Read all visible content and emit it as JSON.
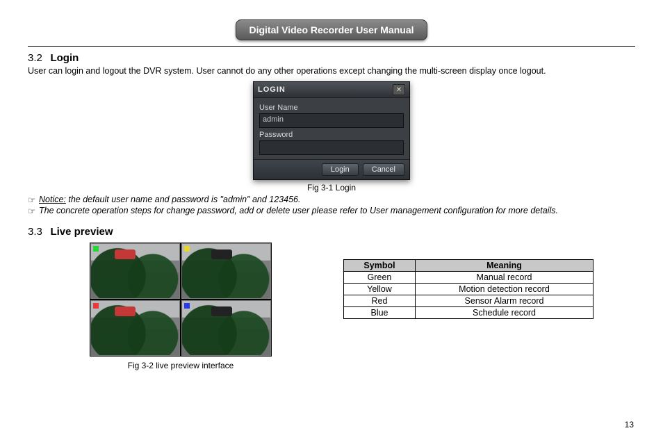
{
  "doc_title": "Digital Video Recorder User Manual",
  "page_number": "13",
  "section32": {
    "num": "3.2",
    "title": "Login",
    "para": "User can login and logout the DVR system. User cannot do any other operations except changing the multi-screen display once logout."
  },
  "login_dialog": {
    "title": "LOGIN",
    "user_label": "User  Name",
    "user_value": "admin",
    "password_label": "Password",
    "password_value": "",
    "login_btn": "Login",
    "cancel_btn": "Cancel",
    "close_glyph": "✕"
  },
  "fig31_caption": "Fig 3-1 Login",
  "note1_prefix": "Notice:",
  "note1_rest": " the default user name and password is \"admin\" and 123456.",
  "note2": "The concrete operation steps for change password, add or delete user please refer to User management configuration for more details.",
  "bullet_glyph": "☞",
  "section33": {
    "num": "3.3",
    "title": "Live preview"
  },
  "fig32_caption": "Fig 3-2 live preview interface",
  "legend": {
    "headers": {
      "symbol": "Symbol",
      "meaning": "Meaning"
    },
    "rows": [
      {
        "symbol": "Green",
        "meaning": "Manual record"
      },
      {
        "symbol": "Yellow",
        "meaning": "Motion detection record"
      },
      {
        "symbol": "Red",
        "meaning": "Sensor Alarm record"
      },
      {
        "symbol": "Blue",
        "meaning": "Schedule record"
      }
    ]
  }
}
